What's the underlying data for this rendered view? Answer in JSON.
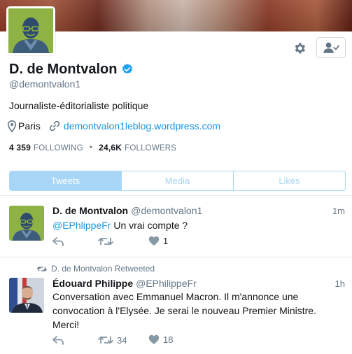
{
  "profile": {
    "name": "D. de Montvalon",
    "handle": "@demontvalon1",
    "bio": "Journaliste-éditorialiste politique",
    "location": "Paris",
    "website": "demontvalon1leblog.wordpress.com",
    "following_count": "4 359",
    "following_label": "FOLLOWING",
    "followers_count": "24,6K",
    "followers_label": "FOLLOWERS",
    "stats_separator": "•"
  },
  "tabs": [
    {
      "label": "Tweets",
      "active": true
    },
    {
      "label": "Media",
      "active": false
    },
    {
      "label": "Likes",
      "active": false
    }
  ],
  "tweets": [
    {
      "name": "D. de Montvalon",
      "handle": "@demontvalon1",
      "time": "1m",
      "mention": "@EPhlippeFr",
      "text": " Un vrai compte ?",
      "retweet_count": "",
      "like_count": "1"
    },
    {
      "retweet_label": "D. de Montvalon Retweeted",
      "name": "Édouard Philippe",
      "handle": "@EPhilippeFr",
      "time": "1h",
      "text": "Conversation avec Emmanuel Macron. Il m'annonce une convocation à l'Elysée. Je serai le nouveau Premier Ministre. Merci!",
      "retweet_count": "34",
      "like_count": "18"
    }
  ],
  "colors": {
    "accent": "#1b95e0",
    "tab_active_bg": "#a8d6f6",
    "avatar_green": "#8fb245",
    "verified": "#1da1f2"
  },
  "icons": [
    "gear-icon",
    "person-check-icon",
    "verified-badge-icon",
    "location-pin-icon",
    "link-icon",
    "reply-icon",
    "retweet-icon",
    "heart-icon"
  ]
}
